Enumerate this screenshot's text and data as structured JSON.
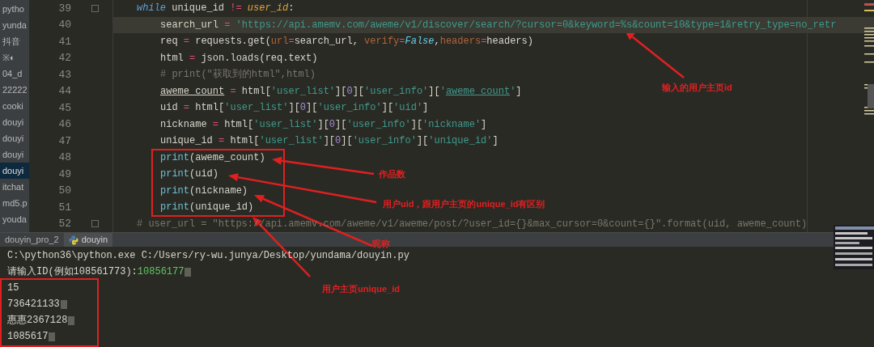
{
  "sidebar": {
    "items": [
      {
        "label": "pytho",
        "selected": false
      },
      {
        "label": "yunda",
        "selected": false
      },
      {
        "label": "抖音",
        "selected": false
      },
      {
        "label": "※◐",
        "selected": false
      },
      {
        "label": "04_d",
        "selected": false
      },
      {
        "label": "22222",
        "selected": false
      },
      {
        "label": "cooki",
        "selected": false
      },
      {
        "label": "douyi",
        "selected": false
      },
      {
        "label": "douyi",
        "selected": false
      },
      {
        "label": "douyi",
        "selected": false
      },
      {
        "label": "douyi",
        "selected": true
      },
      {
        "label": "itchat",
        "selected": false
      },
      {
        "label": "md5.p",
        "selected": false
      },
      {
        "label": "youda",
        "selected": false
      }
    ]
  },
  "editor": {
    "lines": [
      {
        "number": "39",
        "kind": "outer",
        "current": false,
        "fold": true,
        "tokens": [
          {
            "text": "while",
            "kind": "keyword"
          },
          {
            "text": " unique_id ",
            "kind": "plain"
          },
          {
            "text": "!=",
            "kind": "op"
          },
          {
            "text": " user_id",
            "kind": "param"
          },
          {
            "text": ":",
            "kind": "plain"
          }
        ]
      },
      {
        "number": "40",
        "kind": "inner",
        "current": true,
        "fold": false,
        "tokens": [
          {
            "text": "search_url ",
            "kind": "plain"
          },
          {
            "text": "=",
            "kind": "op"
          },
          {
            "text": " 'https://api.amemv.com/aweme/v1/discover/search/?cursor=0&keyword=%s&count=10&type=1&retry_type=no_retr",
            "kind": "string"
          }
        ]
      },
      {
        "number": "41",
        "kind": "inner",
        "current": false,
        "fold": false,
        "tokens": [
          {
            "text": "req ",
            "kind": "plain"
          },
          {
            "text": "=",
            "kind": "op"
          },
          {
            "text": " requests.get(",
            "kind": "plain"
          },
          {
            "text": "url",
            "kind": "kwarg"
          },
          {
            "text": "=",
            "kind": "op"
          },
          {
            "text": "search_url, ",
            "kind": "plain"
          },
          {
            "text": "verify",
            "kind": "kwarg"
          },
          {
            "text": "=",
            "kind": "op"
          },
          {
            "text": "False",
            "kind": "const"
          },
          {
            "text": ",",
            "kind": "plain"
          },
          {
            "text": "headers",
            "kind": "kwarg"
          },
          {
            "text": "=",
            "kind": "op"
          },
          {
            "text": "headers)",
            "kind": "plain"
          }
        ]
      },
      {
        "number": "42",
        "kind": "inner",
        "current": false,
        "fold": false,
        "tokens": [
          {
            "text": "html ",
            "kind": "plain"
          },
          {
            "text": "=",
            "kind": "op"
          },
          {
            "text": " json.loads(req.text)",
            "kind": "plain"
          }
        ]
      },
      {
        "number": "43",
        "kind": "inner",
        "current": false,
        "fold": false,
        "tokens": [
          {
            "text": "# print(\"获取到的html\",html)",
            "kind": "comment"
          }
        ]
      },
      {
        "number": "44",
        "kind": "inner",
        "current": false,
        "fold": false,
        "tokens": [
          {
            "text": "aweme_count",
            "kind": "underlined"
          },
          {
            "text": " =",
            "kind": "op"
          },
          {
            "text": " html[",
            "kind": "plain"
          },
          {
            "text": "'user_list'",
            "kind": "string"
          },
          {
            "text": "][",
            "kind": "plain"
          },
          {
            "text": "0",
            "kind": "number"
          },
          {
            "text": "][",
            "kind": "plain"
          },
          {
            "text": "'user_info'",
            "kind": "string"
          },
          {
            "text": "][",
            "kind": "plain"
          },
          {
            "text": "'",
            "kind": "string"
          },
          {
            "text": "aweme_count",
            "kind": "string_u"
          },
          {
            "text": "'",
            "kind": "string"
          },
          {
            "text": "]",
            "kind": "plain"
          }
        ]
      },
      {
        "number": "45",
        "kind": "inner",
        "current": false,
        "fold": false,
        "tokens": [
          {
            "text": "uid ",
            "kind": "plain"
          },
          {
            "text": "=",
            "kind": "op"
          },
          {
            "text": " html[",
            "kind": "plain"
          },
          {
            "text": "'user_list'",
            "kind": "string"
          },
          {
            "text": "][",
            "kind": "plain"
          },
          {
            "text": "0",
            "kind": "number"
          },
          {
            "text": "][",
            "kind": "plain"
          },
          {
            "text": "'user_info'",
            "kind": "string"
          },
          {
            "text": "][",
            "kind": "plain"
          },
          {
            "text": "'uid'",
            "kind": "string"
          },
          {
            "text": "]",
            "kind": "plain"
          }
        ]
      },
      {
        "number": "46",
        "kind": "inner",
        "current": false,
        "fold": false,
        "tokens": [
          {
            "text": "nickname ",
            "kind": "plain"
          },
          {
            "text": "=",
            "kind": "op"
          },
          {
            "text": " html[",
            "kind": "plain"
          },
          {
            "text": "'user_list'",
            "kind": "string"
          },
          {
            "text": "][",
            "kind": "plain"
          },
          {
            "text": "0",
            "kind": "number"
          },
          {
            "text": "][",
            "kind": "plain"
          },
          {
            "text": "'user_info'",
            "kind": "string"
          },
          {
            "text": "][",
            "kind": "plain"
          },
          {
            "text": "'nickname'",
            "kind": "string"
          },
          {
            "text": "]",
            "kind": "plain"
          }
        ]
      },
      {
        "number": "47",
        "kind": "inner",
        "current": false,
        "fold": false,
        "tokens": [
          {
            "text": "unique_id ",
            "kind": "plain"
          },
          {
            "text": "=",
            "kind": "op"
          },
          {
            "text": " html[",
            "kind": "plain"
          },
          {
            "text": "'user_list'",
            "kind": "string"
          },
          {
            "text": "][",
            "kind": "plain"
          },
          {
            "text": "0",
            "kind": "number"
          },
          {
            "text": "][",
            "kind": "plain"
          },
          {
            "text": "'user_info'",
            "kind": "string"
          },
          {
            "text": "][",
            "kind": "plain"
          },
          {
            "text": "'unique_id'",
            "kind": "string"
          },
          {
            "text": "]",
            "kind": "plain"
          }
        ]
      },
      {
        "number": "48",
        "kind": "inner",
        "current": false,
        "fold": false,
        "tokens": [
          {
            "text": "print",
            "kind": "builtin"
          },
          {
            "text": "(aweme_count)",
            "kind": "plain"
          }
        ]
      },
      {
        "number": "49",
        "kind": "inner",
        "current": false,
        "fold": false,
        "tokens": [
          {
            "text": "print",
            "kind": "builtin"
          },
          {
            "text": "(uid)",
            "kind": "plain"
          }
        ]
      },
      {
        "number": "50",
        "kind": "inner",
        "current": false,
        "fold": false,
        "tokens": [
          {
            "text": "print",
            "kind": "builtin"
          },
          {
            "text": "(nickname)",
            "kind": "plain"
          }
        ]
      },
      {
        "number": "51",
        "kind": "inner",
        "current": false,
        "fold": false,
        "tokens": [
          {
            "text": "print",
            "kind": "builtin"
          },
          {
            "text": "(unique_id)",
            "kind": "plain"
          }
        ]
      },
      {
        "number": "52",
        "kind": "outer",
        "current": false,
        "fold": true,
        "tokens": [
          {
            "text": "# user_url = \"https://api.amemv.com/aweme/v1/aweme/post/?user_id={}&max_cursor=0&count={}\".format(uid, aweme_count)",
            "kind": "comment"
          }
        ]
      }
    ]
  },
  "run_tabs": [
    {
      "label": "douyin_pro_2",
      "selected": false,
      "kind": "plain"
    },
    {
      "label": "douyin",
      "selected": true,
      "kind": "python"
    }
  ],
  "console": {
    "lines": [
      {
        "redacted": false,
        "tokens": [
          {
            "text": "C:\\python36\\python.exe C:/Users/ry-wu.junya/Desktop/yundama/douyin.py",
            "kind": "plain"
          }
        ]
      },
      {
        "redacted": true,
        "tokens": [
          {
            "text": "请输入ID(例如108561773):",
            "kind": "plain"
          },
          {
            "text": "10856177",
            "kind": "input"
          }
        ]
      },
      {
        "redacted": false,
        "tokens": [
          {
            "text": "15",
            "kind": "plain"
          }
        ]
      },
      {
        "redacted": true,
        "tokens": [
          {
            "text": "736421133",
            "kind": "plain"
          }
        ]
      },
      {
        "redacted": true,
        "tokens": [
          {
            "text": "惠惠2367128",
            "kind": "plain"
          }
        ]
      },
      {
        "redacted": true,
        "tokens": [
          {
            "text": "1085617",
            "kind": "plain"
          }
        ]
      }
    ]
  },
  "annotations": [
    {
      "text": "输入的用户主页id"
    },
    {
      "text": "作品数"
    },
    {
      "text": "用户uid，跟用户主页的unique_id有区别"
    },
    {
      "text": "昵称"
    },
    {
      "text": "用户主页unique_id"
    }
  ]
}
